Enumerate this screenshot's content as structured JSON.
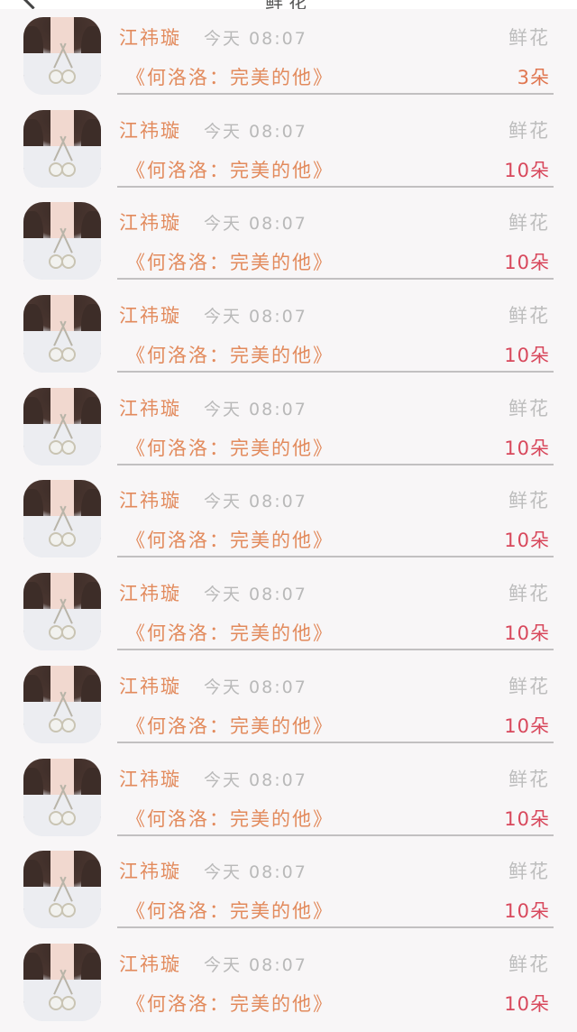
{
  "header": {
    "title": "鲜花"
  },
  "gifts": [
    {
      "user": "江祎璇",
      "time": "今天 08:07",
      "type": "鲜花",
      "title": "《何洛洛：完美的他》",
      "count": "3朵",
      "count_color": "#e07650"
    },
    {
      "user": "江祎璇",
      "time": "今天 08:07",
      "type": "鲜花",
      "title": "《何洛洛：完美的他》",
      "count": "10朵",
      "count_color": "#d8485c"
    },
    {
      "user": "江祎璇",
      "time": "今天 08:07",
      "type": "鲜花",
      "title": "《何洛洛：完美的他》",
      "count": "10朵",
      "count_color": "#d8485c"
    },
    {
      "user": "江祎璇",
      "time": "今天 08:07",
      "type": "鲜花",
      "title": "《何洛洛：完美的他》",
      "count": "10朵",
      "count_color": "#d8485c"
    },
    {
      "user": "江祎璇",
      "time": "今天 08:07",
      "type": "鲜花",
      "title": "《何洛洛：完美的他》",
      "count": "10朵",
      "count_color": "#d8485c"
    },
    {
      "user": "江祎璇",
      "time": "今天 08:07",
      "type": "鲜花",
      "title": "《何洛洛：完美的他》",
      "count": "10朵",
      "count_color": "#d8485c"
    },
    {
      "user": "江祎璇",
      "time": "今天 08:07",
      "type": "鲜花",
      "title": "《何洛洛：完美的他》",
      "count": "10朵",
      "count_color": "#d8485c"
    },
    {
      "user": "江祎璇",
      "time": "今天 08:07",
      "type": "鲜花",
      "title": "《何洛洛：完美的他》",
      "count": "10朵",
      "count_color": "#d8485c"
    },
    {
      "user": "江祎璇",
      "time": "今天 08:07",
      "type": "鲜花",
      "title": "《何洛洛：完美的他》",
      "count": "10朵",
      "count_color": "#d8485c"
    },
    {
      "user": "江祎璇",
      "time": "今天 08:07",
      "type": "鲜花",
      "title": "《何洛洛：完美的他》",
      "count": "10朵",
      "count_color": "#d8485c"
    },
    {
      "user": "江祎璇",
      "time": "今天 08:07",
      "type": "鲜花",
      "title": "《何洛洛：完美的他》",
      "count": "10朵",
      "count_color": "#d8485c"
    }
  ],
  "colors": {
    "name": "#e28a5c",
    "muted": "#bdbdbd",
    "background": "#f8f6f7"
  }
}
